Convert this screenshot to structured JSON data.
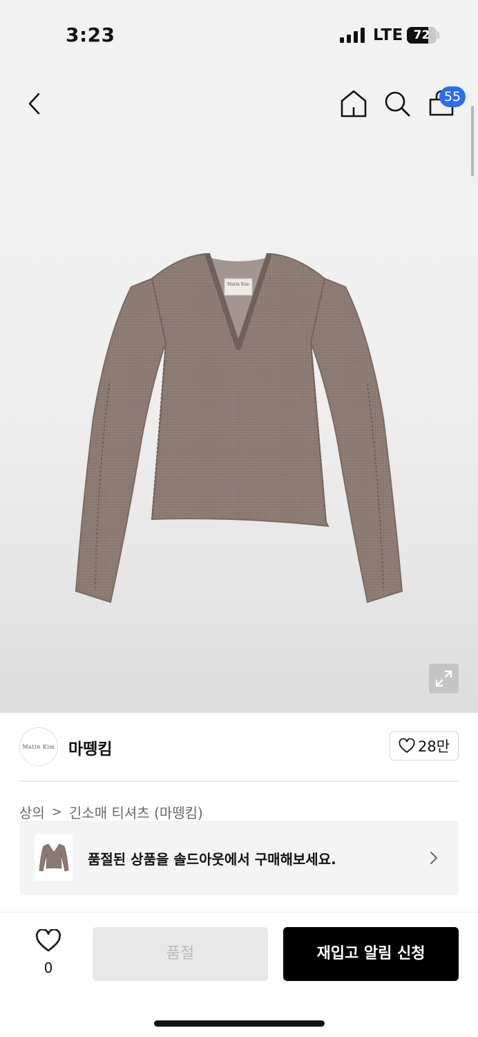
{
  "status_bar": {
    "time": "3:23",
    "network": "LTE",
    "battery_level": "72",
    "battery_fraction": 0.72,
    "icons": [
      "cellular-signal-icon",
      "battery-icon"
    ]
  },
  "top_nav": {
    "icons": [
      "back-chevron-icon",
      "home-icon",
      "search-icon",
      "shopping-bag-icon"
    ],
    "cart_count": "55",
    "badge_color": "#2b6df5"
  },
  "product": {
    "image_label": "Matin Kim",
    "image_alt_icon": "long-sleeve-v-neck-knit-top",
    "expand_icon": "expand-arrows-icon"
  },
  "brand": {
    "logo_text": "Matin  Kim",
    "name": "마뗑킴",
    "likes": "28만"
  },
  "breadcrumb": {
    "items": [
      "상의",
      "긴소매 티셔츠 (마뗑킴)"
    ],
    "separator": ">"
  },
  "soldout_banner": {
    "text": "품절된 상품을 솔드아웃에서 구매해보세요."
  },
  "bottom_bar": {
    "wish_count": "0",
    "soldout_label": "품절",
    "restock_label": "재입고 알림 신청",
    "primary_color": "#000000"
  }
}
